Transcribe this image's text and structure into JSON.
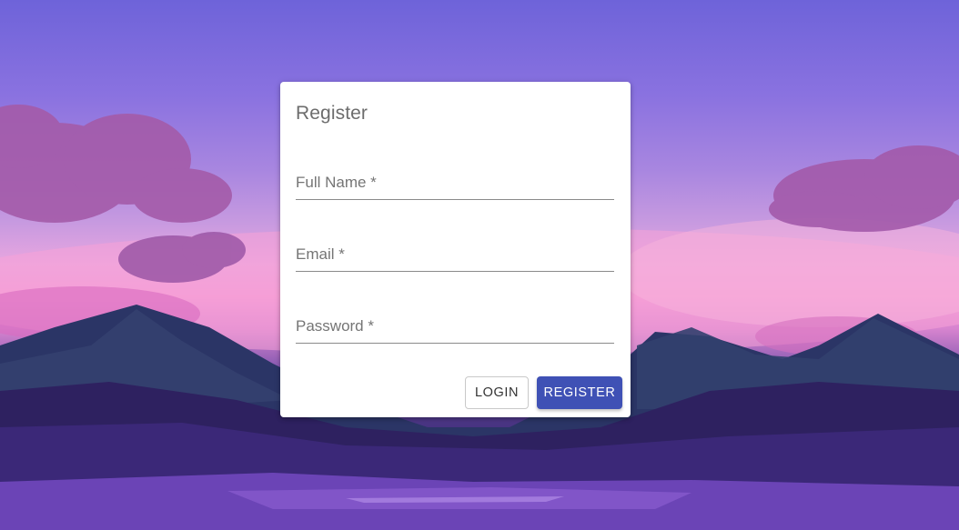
{
  "form": {
    "title": "Register",
    "fields": [
      {
        "label": "Full Name *",
        "value": ""
      },
      {
        "label": "Email *",
        "value": ""
      },
      {
        "label": "Password *",
        "value": ""
      }
    ],
    "login_label": "LOGIN",
    "register_label": "REGISTER"
  },
  "colors": {
    "primary": "#3f51b5",
    "card": "#ffffff"
  }
}
